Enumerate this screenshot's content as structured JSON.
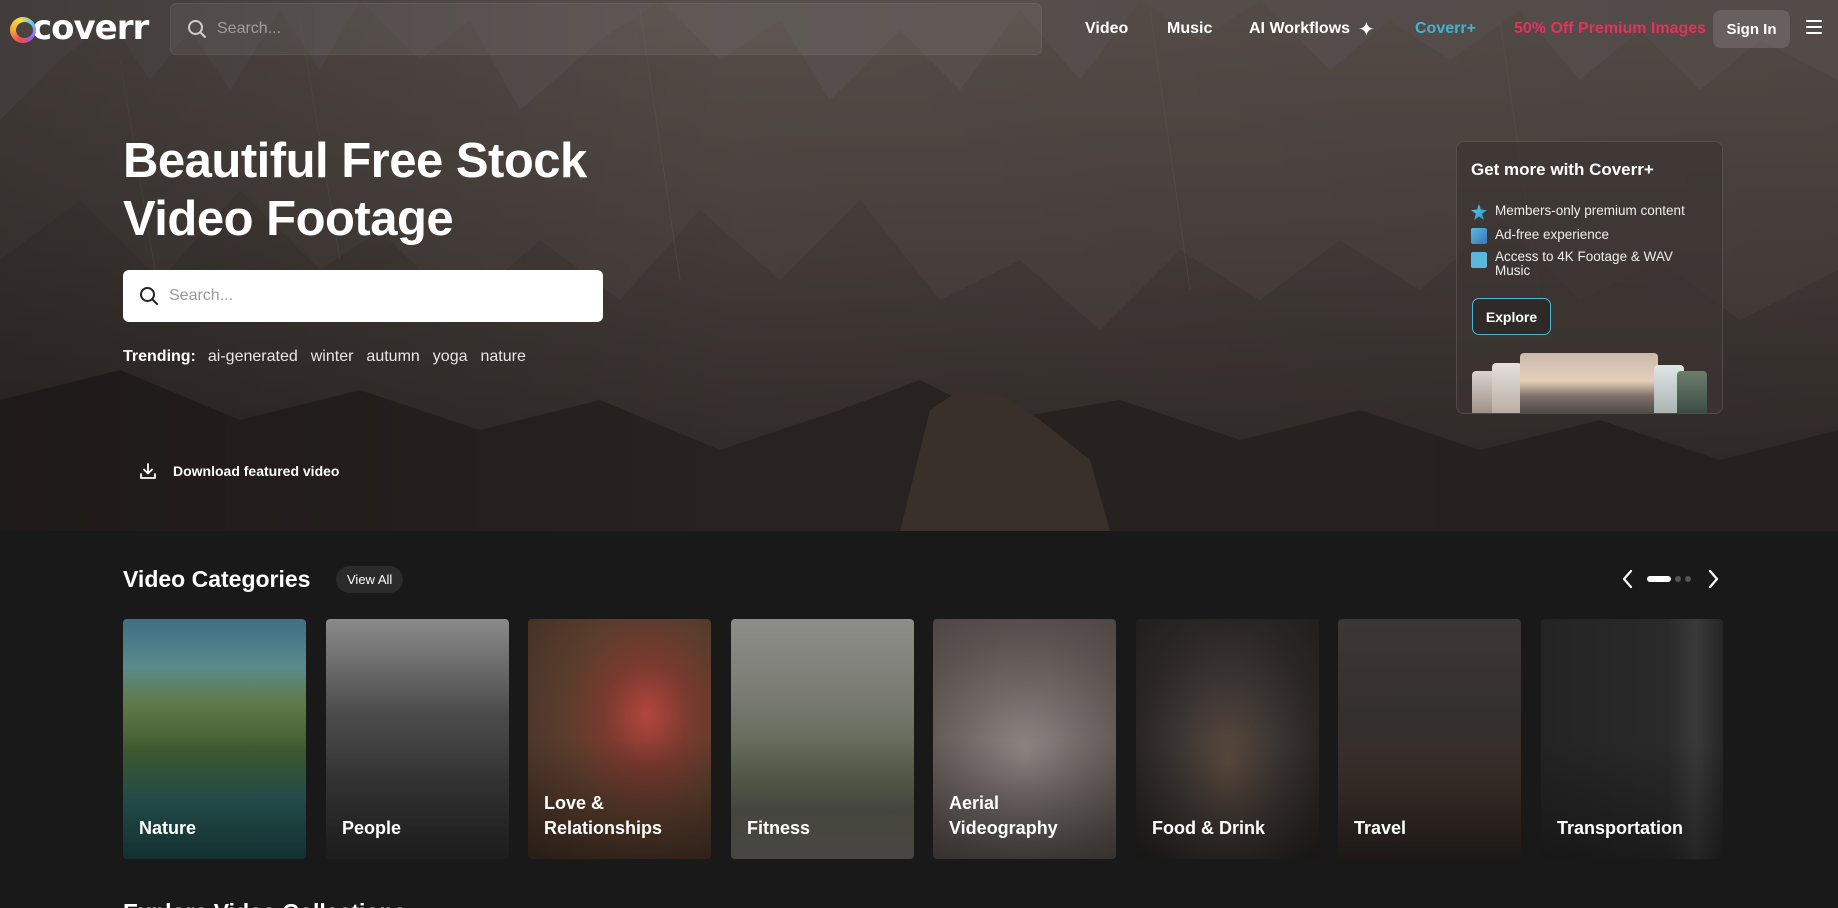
{
  "header": {
    "logo_text": "coverr",
    "search_placeholder": "Search...",
    "nav": {
      "video": "Video",
      "music": "Music",
      "ai_workflows": "AI Workflows",
      "coverr_plus": "Coverr+",
      "promo": "50% Off Premium Images"
    },
    "sign_in": "Sign In"
  },
  "hero": {
    "title": "Beautiful Free Stock Video Footage",
    "search_placeholder": "Search...",
    "trending_label": "Trending:",
    "trending": [
      "ai-generated",
      "winter",
      "autumn",
      "yoga",
      "nature"
    ],
    "download_label": "Download featured video"
  },
  "plus_card": {
    "title": "Get more with Coverr+",
    "features": [
      "Members-only premium content",
      "Ad-free experience",
      "Access to 4K Footage & WAV Music"
    ],
    "explore_label": "Explore"
  },
  "categories": {
    "title": "Video Categories",
    "view_all": "View All",
    "items": [
      "Nature",
      "People",
      "Love & Relationships",
      "Fitness",
      "Aerial Videography",
      "Food & Drink",
      "Travel",
      "Transportation"
    ]
  },
  "next_section_title": "Explore Video Collections",
  "colors": {
    "accent_cyan": "#3fb5d6",
    "promo_pink": "#e3335c",
    "background": "#191919"
  }
}
